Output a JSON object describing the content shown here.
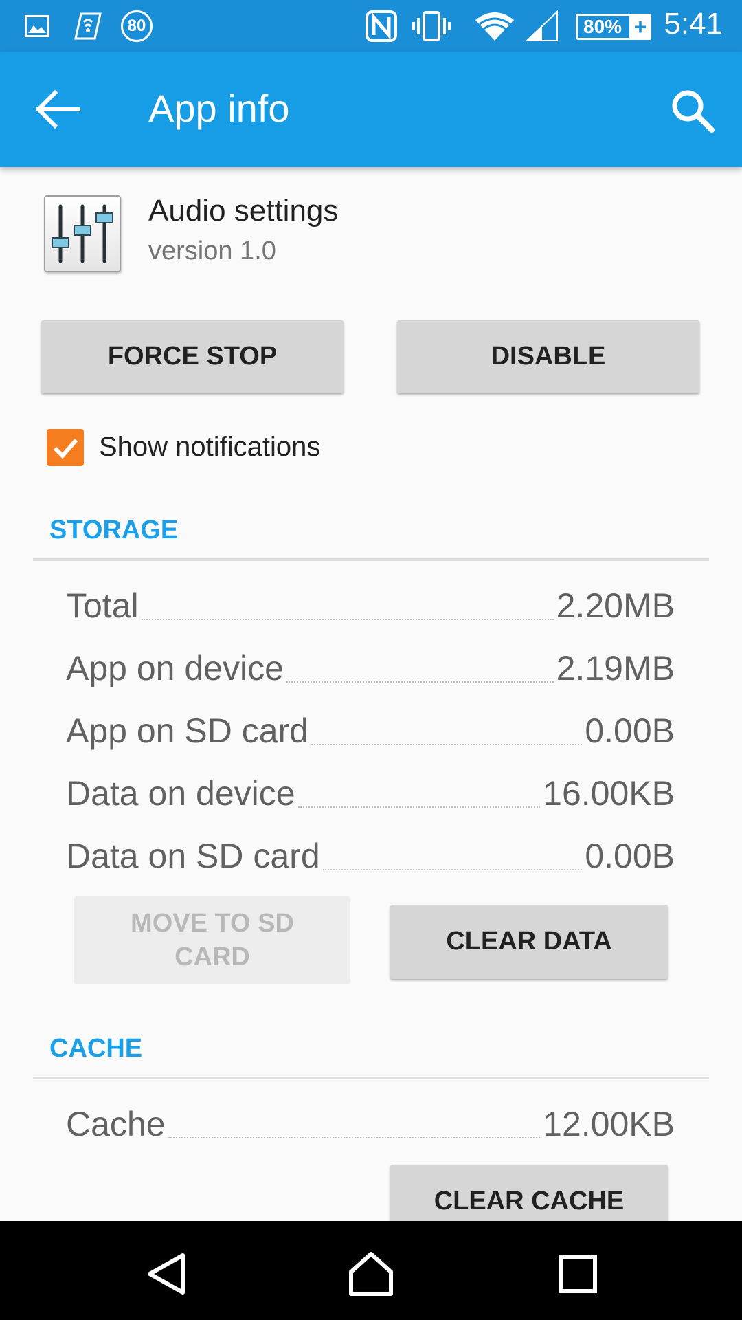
{
  "status_bar": {
    "time": "5:41",
    "battery_percent": "80%",
    "battery_plus": "+",
    "data_badge": "80",
    "icons": [
      "image-icon",
      "sim-toolkit-icon",
      "data-circle-icon",
      "nfc-icon",
      "vibrate-icon",
      "wifi-icon",
      "cell-signal-icon",
      "battery-icon"
    ]
  },
  "app_bar": {
    "title": "App info",
    "back_icon": "arrow-back-icon",
    "search_icon": "search-icon"
  },
  "app": {
    "name": "Audio settings",
    "version": "version 1.0",
    "icon": "equalizer-app-icon"
  },
  "actions": {
    "force_stop": "FORCE STOP",
    "disable": "DISABLE"
  },
  "notifications": {
    "label": "Show notifications",
    "checked": true,
    "check_color": "#f57c1f"
  },
  "storage": {
    "title": "STORAGE",
    "rows": [
      {
        "label": "Total",
        "value": "2.20MB"
      },
      {
        "label": "App on device",
        "value": "2.19MB"
      },
      {
        "label": "App on SD card",
        "value": "0.00B"
      },
      {
        "label": "Data on device",
        "value": "16.00KB"
      },
      {
        "label": "Data on SD card",
        "value": "0.00B"
      }
    ],
    "move_to_sd_line1": "MOVE TO SD",
    "move_to_sd_line2": "CARD",
    "clear_data": "CLEAR DATA"
  },
  "cache": {
    "title": "CACHE",
    "label": "Cache",
    "value": "12.00KB",
    "clear_cache": "CLEAR CACHE"
  },
  "colors": {
    "status_bar": "#1a8fd8",
    "app_bar": "#169de6",
    "accent": "#1aa0e8"
  },
  "nav_bar": {
    "icons": [
      "back-triangle-icon",
      "home-icon",
      "recents-icon"
    ]
  }
}
